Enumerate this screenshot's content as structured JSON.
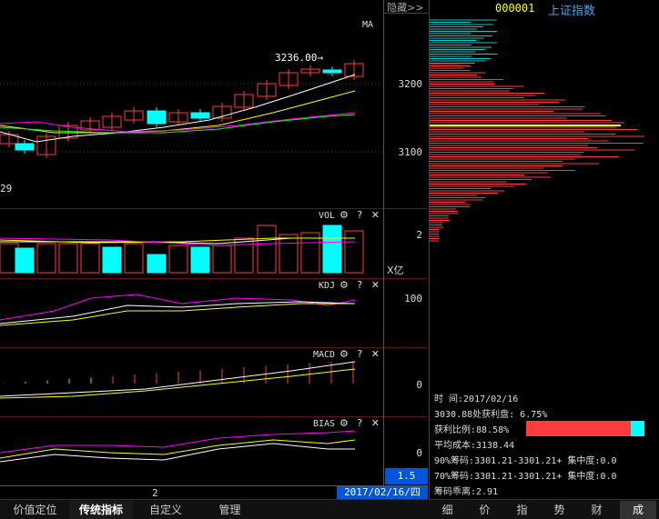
{
  "header": {
    "hide_label": "隐藏>>",
    "ma_label": "MA",
    "code": "000001",
    "name": "上证指数"
  },
  "main_chart": {
    "price_marker": "3236.00→",
    "partial_label": "29"
  },
  "axis": {
    "main_ticks": [
      "3200",
      "3100"
    ],
    "vol_tick": "2",
    "vol_unit": "X亿",
    "kdj_tick": "100",
    "macd_tick": "0",
    "bias_tick": "0",
    "bottom_value": "1.5"
  },
  "indicators": {
    "vol": "VOL",
    "kdj": "KDJ",
    "macd": "MACD",
    "bias": "BIAS",
    "btns": "⚙ ? ✕"
  },
  "x_axis": {
    "mid_label": "2",
    "date_box": "2017/02/16/四"
  },
  "info": {
    "time": "时    间:2017/02/16",
    "profit_at": "3030.88处获利盘: 6.75%",
    "profit_ratio": "获利比例:88.58%",
    "profit_ratio_value": 0.8858,
    "avg_cost": "平均成本:3138.44",
    "chip90": "90%筹码:3301.21-3301.21+ 集中度:0.0",
    "chip70": "70%筹码:3301.21-3301.21+ 集中度:0.0",
    "chip_dev": "筹码乖离:2.91"
  },
  "bottom_tabs": [
    "价值定位",
    "传统指标",
    "自定义",
    "管理"
  ],
  "right_tabs": [
    "细",
    "价",
    "指",
    "势",
    "财",
    "成"
  ],
  "colors": {
    "up": "#ff3c3c",
    "down": "#00ffff",
    "ma1": "#ffffff",
    "ma2": "#ffff00",
    "ma3": "#ff00ff",
    "ma4": "#00ff00",
    "blue": "#0055dd"
  }
}
